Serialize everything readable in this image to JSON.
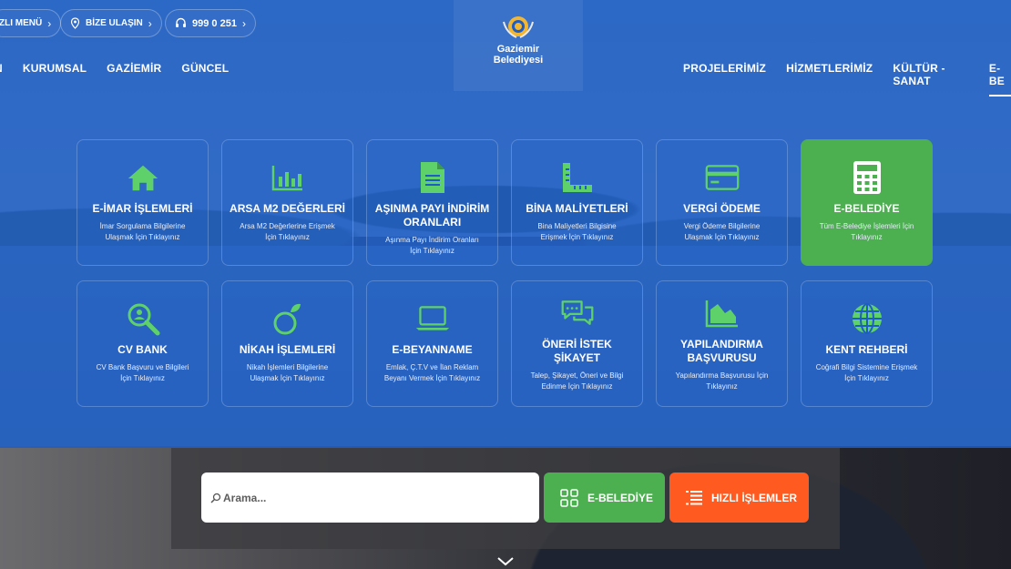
{
  "topbar": {
    "menu_label": "ZLI MENÜ",
    "contact_label": "BİZE ULAŞIN",
    "phone_label": "999 0 251"
  },
  "logo": {
    "line1": "Gaziemir",
    "line2": "Belediyesi"
  },
  "nav": {
    "left": [
      "N",
      "KURUMSAL",
      "GAZİEMİR",
      "GÜNCEL"
    ],
    "right": [
      "PROJELERİMİZ",
      "HİZMETLERİMİZ",
      "KÜLTÜR - SANAT",
      "E-BE"
    ]
  },
  "cards": [
    {
      "title": "E-İMAR İŞLEMLERİ",
      "desc": "İmar Sorgulama Bilgilerine Ulaşmak İçin Tıklayınız",
      "icon": "home-icon"
    },
    {
      "title": "ARSA M2 DEĞERLERİ",
      "desc": "Arsa M2 Değerlerine Erişmek İçin Tıklayınız",
      "icon": "bar-chart-icon"
    },
    {
      "title": "AŞINMA PAYI İNDİRİM ORANLARI",
      "desc": "Aşınma Payı İndirim Oranları İçin Tıklayınız",
      "icon": "document-icon"
    },
    {
      "title": "BİNA MALİYETLERİ",
      "desc": "Bina Maliyetleri Bilgisine Erişmek İçin Tıklayınız",
      "icon": "ruler-icon"
    },
    {
      "title": "VERGİ ÖDEME",
      "desc": "Vergi Ödeme Bilgilerine Ulaşmak İçin Tıklayınız",
      "icon": "credit-card-icon"
    },
    {
      "title": "E-BELEDİYE",
      "desc": "Tüm E-Belediye İşlemleri İçin Tıklayınız",
      "icon": "calculator-icon"
    },
    {
      "title": "CV BANK",
      "desc": "CV Bank Başvuru ve Bilgileri İçin Tıklayınız",
      "icon": "search-person-icon"
    },
    {
      "title": "NİKAH İŞLEMLERİ",
      "desc": "Nikah İşlemleri Bilgilerine Ulaşmak İçin Tıklayınız",
      "icon": "ring-icon"
    },
    {
      "title": "E-BEYANNAME",
      "desc": "Emlak, Ç.T.V ve İlan Reklam Beyanı Vermek İçin Tıklayınız",
      "icon": "laptop-icon"
    },
    {
      "title": "ÖNERİ İSTEK ŞİKAYET",
      "desc": "Talep, Şikayet, Öneri ve Bilgi Edinme İçin Tıklayınız",
      "icon": "chat-icon"
    },
    {
      "title": "YAPILANDIRMA BAŞVURUSU",
      "desc": "Yapılandırma Başvurusu İçin Tıklayınız",
      "icon": "area-chart-icon"
    },
    {
      "title": "KENT REHBERİ",
      "desc": "Coğrafi Bilgi Sistemine Erişmek İçin Tıklayınız",
      "icon": "globe-icon"
    }
  ],
  "search": {
    "placeholder": "Arama..."
  },
  "buttons": {
    "ebelediye": "E-BELEDİYE",
    "hizli": "HIZLI İŞLEMLER"
  },
  "colors": {
    "overlay": "#1e5dc4",
    "green": "#4caf50",
    "orange": "#ff5a1f",
    "icon_green": "#5fd16a"
  }
}
